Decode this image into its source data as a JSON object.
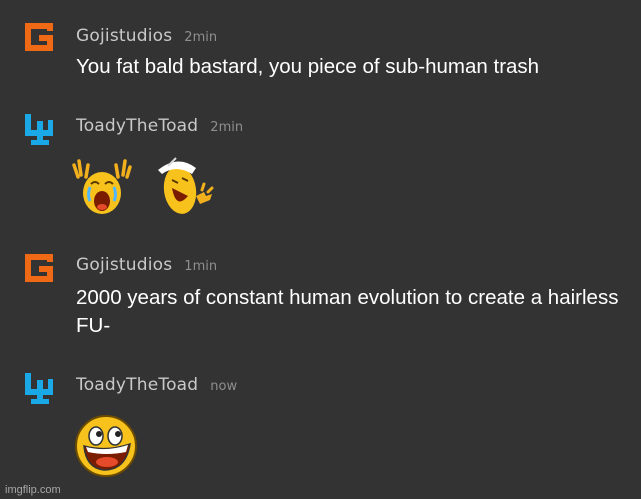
{
  "messages": [
    {
      "username": "Gojistudios",
      "time": "2min",
      "text": "You fat bald bastard, you piece of sub-human trash",
      "avatar_icon": "gojistudios-g-logo-icon"
    },
    {
      "username": "ToadyTheToad",
      "time": "2min",
      "emojis": [
        "crying-emoji-icon",
        "laughing-emoji-icon"
      ],
      "avatar_icon": "toady-blue-logo-icon"
    },
    {
      "username": "Gojistudios",
      "time": "1min",
      "text": "2000 years of constant human evolution to create a hairless FU-",
      "avatar_icon": "gojistudios-g-logo-icon"
    },
    {
      "username": "ToadyTheToad",
      "time": "now",
      "emojis": [
        "awesome-face-emoji-icon"
      ],
      "avatar_icon": "toady-blue-logo-icon"
    }
  ],
  "watermark": "imgflip.com",
  "colors": {
    "background": "#333333",
    "goji_orange": "#f06a16",
    "toady_blue": "#1aa9e6",
    "emoji_yellow": "#f7c21c"
  }
}
